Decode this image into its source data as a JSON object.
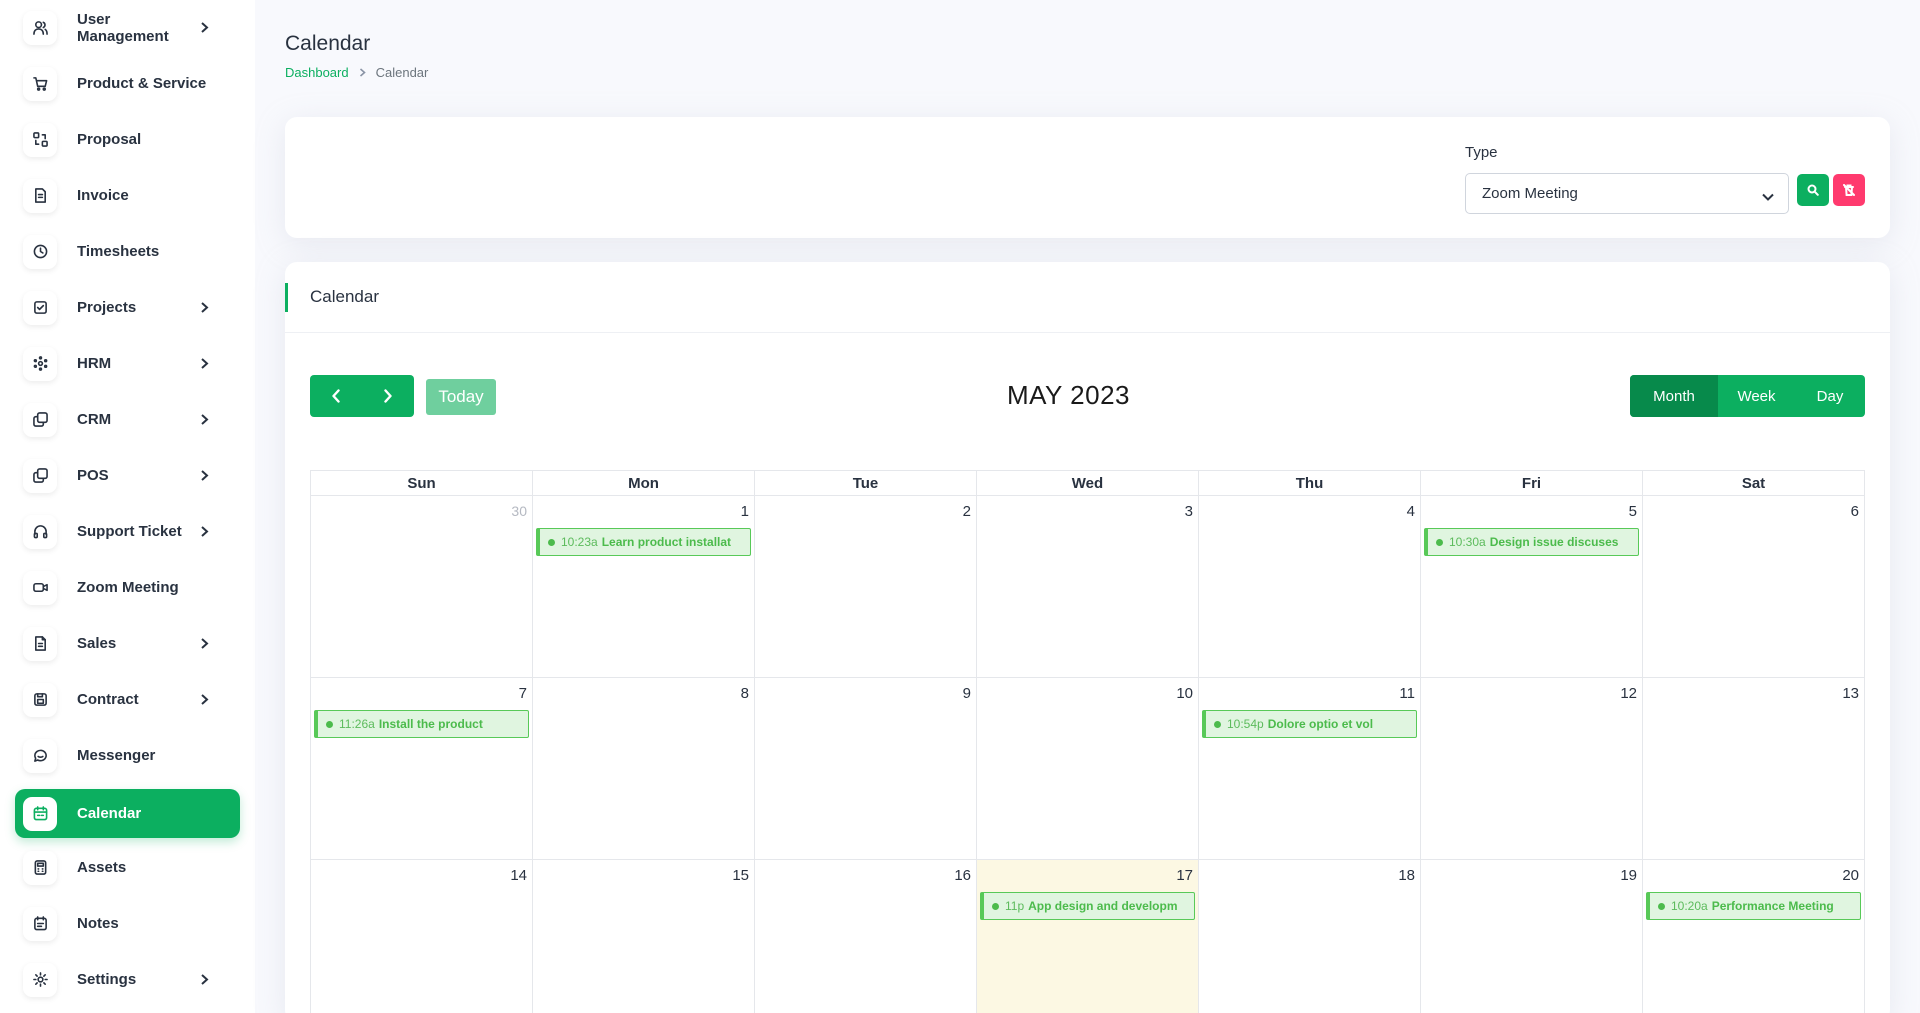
{
  "sidebar": {
    "items": [
      {
        "label": "User Management",
        "icon": "users-icon",
        "has_chevron": true
      },
      {
        "label": "Product & Service",
        "icon": "cart-icon",
        "has_chevron": false
      },
      {
        "label": "Proposal",
        "icon": "proposal-icon",
        "has_chevron": false
      },
      {
        "label": "Invoice",
        "icon": "invoice-icon",
        "has_chevron": false
      },
      {
        "label": "Timesheets",
        "icon": "clock-icon",
        "has_chevron": false
      },
      {
        "label": "Projects",
        "icon": "checklist-icon",
        "has_chevron": true
      },
      {
        "label": "HRM",
        "icon": "hrm-icon",
        "has_chevron": true
      },
      {
        "label": "CRM",
        "icon": "layers-icon",
        "has_chevron": true
      },
      {
        "label": "POS",
        "icon": "layers-icon",
        "has_chevron": true
      },
      {
        "label": "Support Ticket",
        "icon": "headphones-icon",
        "has_chevron": true
      },
      {
        "label": "Zoom Meeting",
        "icon": "video-icon",
        "has_chevron": false
      },
      {
        "label": "Sales",
        "icon": "file-icon",
        "has_chevron": true
      },
      {
        "label": "Contract",
        "icon": "contract-icon",
        "has_chevron": true
      },
      {
        "label": "Messenger",
        "icon": "chat-icon",
        "has_chevron": false
      },
      {
        "label": "Calendar",
        "icon": "calendar-icon",
        "has_chevron": false,
        "active": true
      },
      {
        "label": "Assets",
        "icon": "calculator-icon",
        "has_chevron": false
      },
      {
        "label": "Notes",
        "icon": "notes-icon",
        "has_chevron": false
      },
      {
        "label": "Settings",
        "icon": "gear-icon",
        "has_chevron": true
      }
    ]
  },
  "header": {
    "title": "Calendar",
    "breadcrumb": {
      "home": "Dashboard",
      "current": "Calendar"
    }
  },
  "filter": {
    "type_label": "Type",
    "type_value": "Zoom Meeting",
    "search_icon": "search-icon",
    "reset_icon": "trash-off-icon"
  },
  "calendar": {
    "card_title": "Calendar",
    "month_title": "MAY 2023",
    "today_label": "Today",
    "views": [
      "Month",
      "Week",
      "Day"
    ],
    "active_view": "Month",
    "weekdays": [
      "Sun",
      "Mon",
      "Tue",
      "Wed",
      "Thu",
      "Fri",
      "Sat"
    ],
    "weeks": [
      [
        {
          "day": "30",
          "other": true
        },
        {
          "day": "1",
          "event": {
            "time": "10:23a",
            "title": "Learn product installat"
          }
        },
        {
          "day": "2"
        },
        {
          "day": "3"
        },
        {
          "day": "4"
        },
        {
          "day": "5",
          "event": {
            "time": "10:30a",
            "title": "Design issue discuses"
          }
        },
        {
          "day": "6"
        }
      ],
      [
        {
          "day": "7",
          "event": {
            "time": "11:26a",
            "title": "Install the product"
          }
        },
        {
          "day": "8"
        },
        {
          "day": "9"
        },
        {
          "day": "10"
        },
        {
          "day": "11",
          "event": {
            "time": "10:54p",
            "title": "Dolore optio et vol"
          }
        },
        {
          "day": "12"
        },
        {
          "day": "13"
        }
      ],
      [
        {
          "day": "14"
        },
        {
          "day": "15"
        },
        {
          "day": "16"
        },
        {
          "day": "17",
          "today": true,
          "event": {
            "time": "11p",
            "title": "App design and developm"
          }
        },
        {
          "day": "18"
        },
        {
          "day": "19"
        },
        {
          "day": "20",
          "event": {
            "time": "10:20a",
            "title": "Performance Meeting"
          }
        }
      ]
    ]
  },
  "colors": {
    "accent": "#0caf60",
    "danger": "#ff3a6e",
    "event_bg": "#e0f5e0",
    "event_border": "#58c958",
    "today_bg": "#fcf8e3"
  }
}
